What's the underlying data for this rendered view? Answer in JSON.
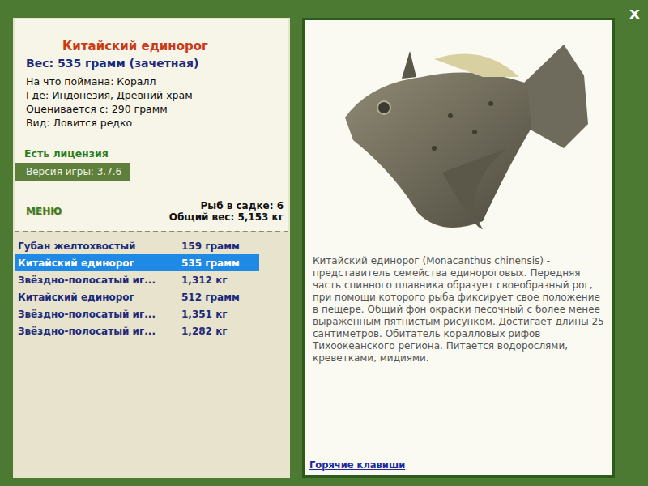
{
  "close": "x",
  "fish": {
    "name": "Китайский единорог",
    "weight": "Вес: 535 грамм (зачетная)",
    "details": [
      "На что поймана: Коралл",
      "Где: Индонезия, Древний храм",
      "Оценивается с: 290 грамм",
      "Вид: Ловится редко"
    ]
  },
  "license": "Есть лицензия",
  "version": "Версия игры: 3.7.6",
  "menu": "МЕНЮ",
  "keepnet": {
    "count": "Рыб в садке: 6",
    "total": "Общий вес: 5,153 кг"
  },
  "catch": [
    {
      "name": "Губан желтохвостый",
      "weight": "159 грамм",
      "selected": false
    },
    {
      "name": "Китайский единорог",
      "weight": "535 грамм",
      "selected": true
    },
    {
      "name": "Звёздно-полосатый иг...",
      "weight": "1,312 кг",
      "selected": false
    },
    {
      "name": "Китайский единорог",
      "weight": "512 грамм",
      "selected": false
    },
    {
      "name": "Звёздно-полосатый иг...",
      "weight": "1,351 кг",
      "selected": false
    },
    {
      "name": "Звёздно-полосатый иг...",
      "weight": "1,282 кг",
      "selected": false
    }
  ],
  "description": "Китайский единорог (Monacanthus chinensis) - представитель семейства единороговых. Передняя часть спинного плавника образует своеобразный рог, при помощи которого рыба фиксирует свое положение в пещере. Общий фон окраски песочный с более менее выраженным пятнистым рисунком. Достигает длины 25 сантиметров. Обитатель коралловых рифов Тихоокеанского региона. Питается водорослями, креветками, мидиями.",
  "hotkeys": "Горячие клавиши"
}
